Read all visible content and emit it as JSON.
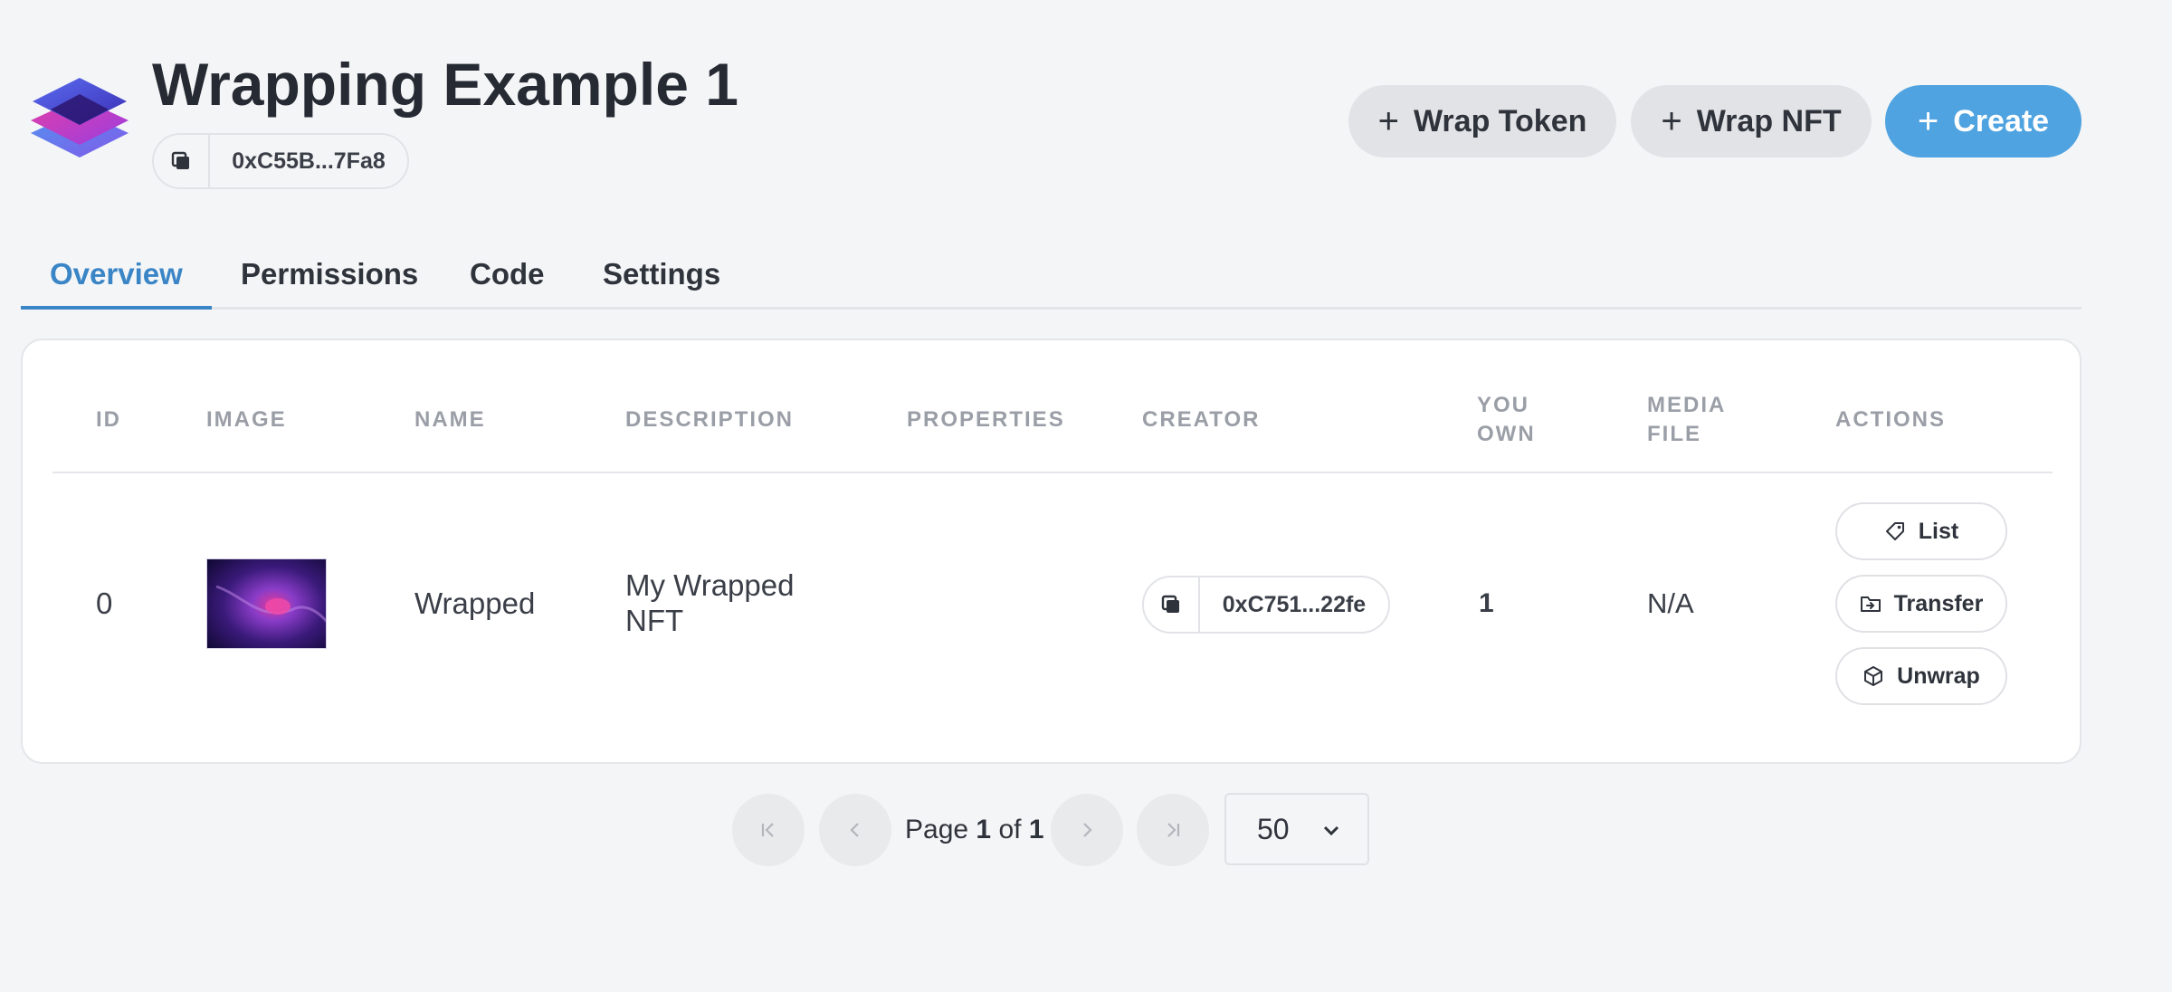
{
  "header": {
    "title": "Wrapping Example 1",
    "contract_address": "0xC55B...7Fa8",
    "buttons": {
      "wrap_token": "Wrap Token",
      "wrap_nft": "Wrap NFT",
      "create": "Create"
    },
    "logo_icon": "layers-logo-icon"
  },
  "tabs": [
    {
      "label": "Overview",
      "active": true
    },
    {
      "label": "Permissions",
      "active": false
    },
    {
      "label": "Code",
      "active": false
    },
    {
      "label": "Settings",
      "active": false
    }
  ],
  "table": {
    "columns": {
      "id": "ID",
      "image": "IMAGE",
      "name": "NAME",
      "description": "DESCRIPTION",
      "properties": "PROPERTIES",
      "creator": "CREATOR",
      "you_own_1": "YOU",
      "you_own_2": "OWN",
      "media_file_1": "MEDIA",
      "media_file_2": "FILE",
      "actions": "ACTIONS"
    },
    "rows": [
      {
        "id": "0",
        "name": "Wrapped",
        "description_1": "My Wrapped",
        "description_2": "NFT",
        "properties": "",
        "creator": "0xC751...22fe",
        "you_own": "1",
        "media_file": "N/A",
        "actions": {
          "list": "List",
          "transfer": "Transfer",
          "unwrap": "Unwrap"
        }
      }
    ]
  },
  "pagination": {
    "page_label": "Page",
    "current_page": "1",
    "of_label": "of",
    "total_pages": "1",
    "page_size": "50"
  },
  "colors": {
    "accent": "#4fa3e0",
    "tab_active": "#3a85c6",
    "background": "#f4f5f7"
  }
}
